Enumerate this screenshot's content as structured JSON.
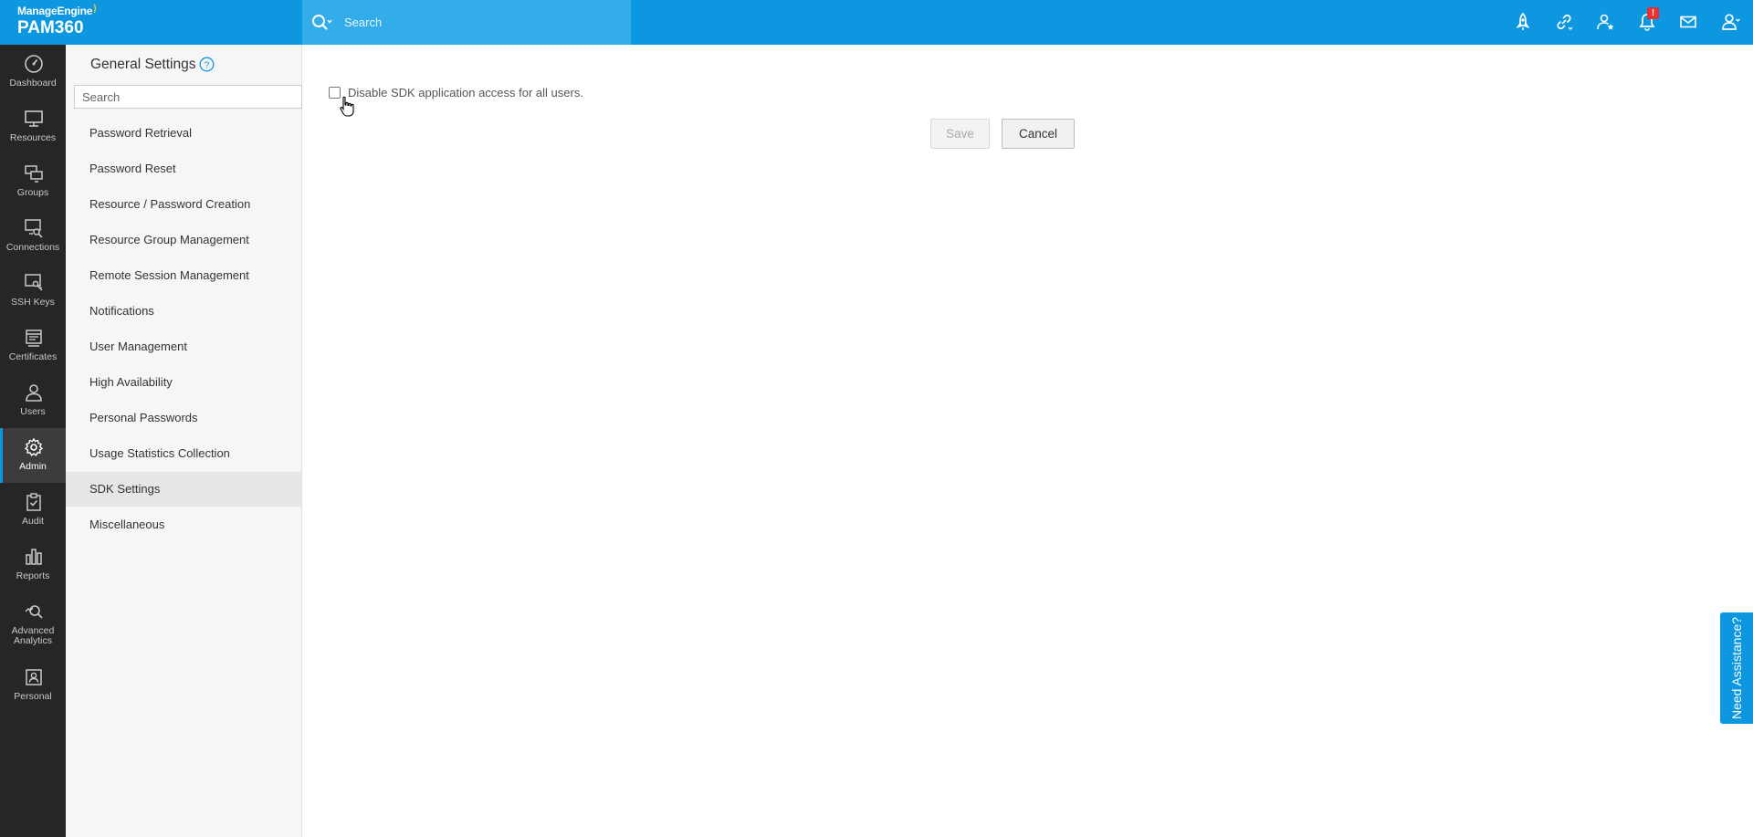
{
  "brand": {
    "company": "ManageEngine",
    "product": "PAM360"
  },
  "top_search": {
    "placeholder": "Search"
  },
  "top_icons": [
    {
      "name": "rocket-icon"
    },
    {
      "name": "link-icon"
    },
    {
      "name": "user-star-icon"
    },
    {
      "name": "bell-icon",
      "badge": "!"
    },
    {
      "name": "mail-icon"
    },
    {
      "name": "user-menu-icon"
    }
  ],
  "leftnav": {
    "items": [
      {
        "label": "Dashboard",
        "icon": "dashboard-icon"
      },
      {
        "label": "Resources",
        "icon": "monitor-icon"
      },
      {
        "label": "Groups",
        "icon": "groups-icon"
      },
      {
        "label": "Connections",
        "icon": "connections-icon"
      },
      {
        "label": "SSH Keys",
        "icon": "ssh-key-icon"
      },
      {
        "label": "Certificates",
        "icon": "certificate-icon"
      },
      {
        "label": "Users",
        "icon": "user-icon"
      },
      {
        "label": "Admin",
        "icon": "gear-icon",
        "active": true
      },
      {
        "label": "Audit",
        "icon": "clipboard-check-icon"
      },
      {
        "label": "Reports",
        "icon": "bar-chart-icon"
      },
      {
        "label": "Advanced Analytics",
        "icon": "analytics-icon"
      },
      {
        "label": "Personal",
        "icon": "personal-icon"
      }
    ]
  },
  "settings": {
    "title": "General Settings",
    "search_placeholder": "Search",
    "items": [
      {
        "label": "Password Retrieval"
      },
      {
        "label": "Password Reset"
      },
      {
        "label": "Resource / Password Creation"
      },
      {
        "label": "Resource Group Management"
      },
      {
        "label": "Remote Session Management"
      },
      {
        "label": "Notifications"
      },
      {
        "label": "User Management"
      },
      {
        "label": "High Availability"
      },
      {
        "label": "Personal Passwords"
      },
      {
        "label": "Usage Statistics Collection"
      },
      {
        "label": "SDK Settings",
        "active": true
      },
      {
        "label": "Miscellaneous"
      }
    ]
  },
  "main": {
    "checkbox_label": "Disable SDK application access for all users.",
    "checkbox_checked": false,
    "save_label": "Save",
    "cancel_label": "Cancel"
  },
  "assist": {
    "label": "Need Assistance?"
  },
  "colors": {
    "brand_blue": "#0c97e0",
    "nav_dark": "#262626",
    "badge_red": "#e8312f"
  }
}
